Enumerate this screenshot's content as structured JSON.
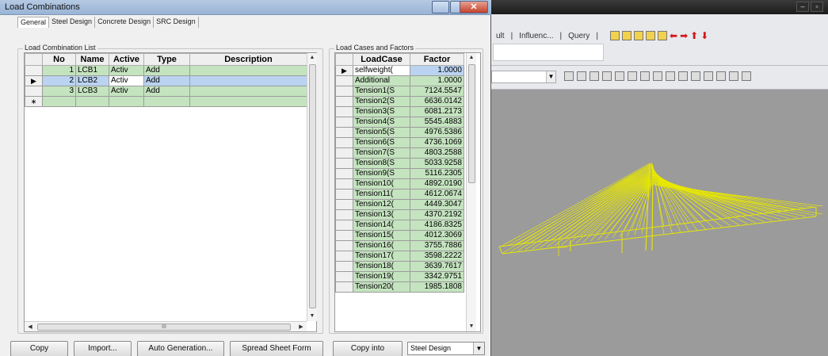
{
  "dialog": {
    "title": "Load Combinations",
    "close_glyph": "✕",
    "tabs": [
      "General",
      "Steel Design",
      "Concrete Design",
      "SRC Design"
    ],
    "combination_list": {
      "group_label": "Load Combination List",
      "columns": [
        "No",
        "Name",
        "Active",
        "Type",
        "Description"
      ],
      "rows": [
        {
          "indicator": "",
          "no": "1",
          "name": "LCB1",
          "active": "Activ",
          "type": "Add",
          "description": ""
        },
        {
          "indicator": "▶",
          "no": "2",
          "name": "LCB2",
          "active": "Activ",
          "type": "Add",
          "description": ""
        },
        {
          "indicator": "",
          "no": "3",
          "name": "LCB3",
          "active": "Activ",
          "type": "Add",
          "description": ""
        },
        {
          "indicator": "∗",
          "no": "",
          "name": "",
          "active": "",
          "type": "",
          "description": ""
        }
      ],
      "hscroll_thumb_glyph": "III"
    },
    "load_cases": {
      "group_label": "Load Cases and Factors",
      "columns": [
        "LoadCase",
        "Factor"
      ],
      "rows": [
        {
          "indicator": "▶",
          "case": "selfweight(",
          "factor": "1.0000"
        },
        {
          "indicator": "",
          "case": "Additional",
          "factor": "1.0000"
        },
        {
          "indicator": "",
          "case": "Tension1(S",
          "factor": "7124.5547"
        },
        {
          "indicator": "",
          "case": "Tension2(S",
          "factor": "6636.0142"
        },
        {
          "indicator": "",
          "case": "Tension3(S",
          "factor": "6081.2173"
        },
        {
          "indicator": "",
          "case": "Tension4(S",
          "factor": "5545.4883"
        },
        {
          "indicator": "",
          "case": "Tension5(S",
          "factor": "4976.5386"
        },
        {
          "indicator": "",
          "case": "Tension6(S",
          "factor": "4736.1069"
        },
        {
          "indicator": "",
          "case": "Tension7(S",
          "factor": "4803.2588"
        },
        {
          "indicator": "",
          "case": "Tension8(S",
          "factor": "5033.9258"
        },
        {
          "indicator": "",
          "case": "Tension9(S",
          "factor": "5116.2305"
        },
        {
          "indicator": "",
          "case": "Tension10(",
          "factor": "4892.0190"
        },
        {
          "indicator": "",
          "case": "Tension11(",
          "factor": "4612.0674"
        },
        {
          "indicator": "",
          "case": "Tension12(",
          "factor": "4449.3047"
        },
        {
          "indicator": "",
          "case": "Tension13(",
          "factor": "4370.2192"
        },
        {
          "indicator": "",
          "case": "Tension14(",
          "factor": "4186.8325"
        },
        {
          "indicator": "",
          "case": "Tension15(",
          "factor": "4012.3069"
        },
        {
          "indicator": "",
          "case": "Tension16(",
          "factor": "3755.7886"
        },
        {
          "indicator": "",
          "case": "Tension17(",
          "factor": "3598.2222"
        },
        {
          "indicator": "",
          "case": "Tension18(",
          "factor": "3639.7617"
        },
        {
          "indicator": "",
          "case": "Tension19(",
          "factor": "3342.9751"
        },
        {
          "indicator": "",
          "case": "Tension20(",
          "factor": "1985.1808"
        }
      ]
    },
    "buttons": {
      "copy": "Copy",
      "import": "Import...",
      "auto_generation": "Auto Generation...",
      "spread_sheet": "Spread Sheet Form",
      "copy_into": "Copy into"
    },
    "design_select": {
      "value": "Steel Design"
    }
  },
  "background_app": {
    "ribbon_tabs": [
      "ult",
      "Influenc...",
      "Query"
    ]
  },
  "colors": {
    "row_green": "#c4e3bf",
    "row_selected": "#bad3f0",
    "model_lines": "#e8e800",
    "viewport": "#9b9b9b"
  }
}
